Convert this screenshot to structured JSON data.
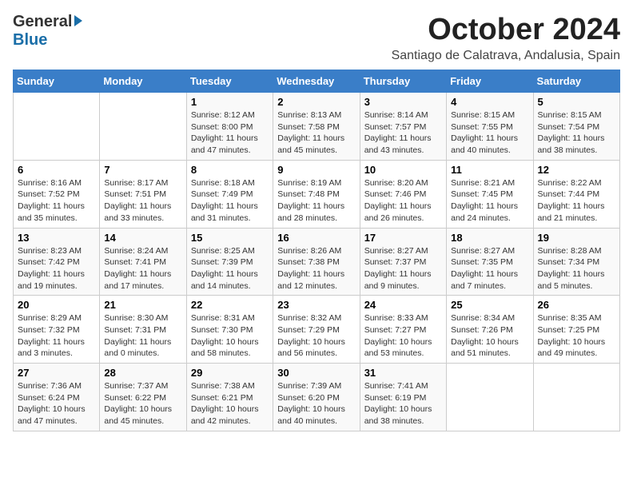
{
  "logo": {
    "general": "General",
    "blue": "Blue"
  },
  "title": "October 2024",
  "location": "Santiago de Calatrava, Andalusia, Spain",
  "headers": [
    "Sunday",
    "Monday",
    "Tuesday",
    "Wednesday",
    "Thursday",
    "Friday",
    "Saturday"
  ],
  "weeks": [
    [
      {
        "day": "",
        "info": ""
      },
      {
        "day": "",
        "info": ""
      },
      {
        "day": "1",
        "info": "Sunrise: 8:12 AM\nSunset: 8:00 PM\nDaylight: 11 hours and 47 minutes."
      },
      {
        "day": "2",
        "info": "Sunrise: 8:13 AM\nSunset: 7:58 PM\nDaylight: 11 hours and 45 minutes."
      },
      {
        "day": "3",
        "info": "Sunrise: 8:14 AM\nSunset: 7:57 PM\nDaylight: 11 hours and 43 minutes."
      },
      {
        "day": "4",
        "info": "Sunrise: 8:15 AM\nSunset: 7:55 PM\nDaylight: 11 hours and 40 minutes."
      },
      {
        "day": "5",
        "info": "Sunrise: 8:15 AM\nSunset: 7:54 PM\nDaylight: 11 hours and 38 minutes."
      }
    ],
    [
      {
        "day": "6",
        "info": "Sunrise: 8:16 AM\nSunset: 7:52 PM\nDaylight: 11 hours and 35 minutes."
      },
      {
        "day": "7",
        "info": "Sunrise: 8:17 AM\nSunset: 7:51 PM\nDaylight: 11 hours and 33 minutes."
      },
      {
        "day": "8",
        "info": "Sunrise: 8:18 AM\nSunset: 7:49 PM\nDaylight: 11 hours and 31 minutes."
      },
      {
        "day": "9",
        "info": "Sunrise: 8:19 AM\nSunset: 7:48 PM\nDaylight: 11 hours and 28 minutes."
      },
      {
        "day": "10",
        "info": "Sunrise: 8:20 AM\nSunset: 7:46 PM\nDaylight: 11 hours and 26 minutes."
      },
      {
        "day": "11",
        "info": "Sunrise: 8:21 AM\nSunset: 7:45 PM\nDaylight: 11 hours and 24 minutes."
      },
      {
        "day": "12",
        "info": "Sunrise: 8:22 AM\nSunset: 7:44 PM\nDaylight: 11 hours and 21 minutes."
      }
    ],
    [
      {
        "day": "13",
        "info": "Sunrise: 8:23 AM\nSunset: 7:42 PM\nDaylight: 11 hours and 19 minutes."
      },
      {
        "day": "14",
        "info": "Sunrise: 8:24 AM\nSunset: 7:41 PM\nDaylight: 11 hours and 17 minutes."
      },
      {
        "day": "15",
        "info": "Sunrise: 8:25 AM\nSunset: 7:39 PM\nDaylight: 11 hours and 14 minutes."
      },
      {
        "day": "16",
        "info": "Sunrise: 8:26 AM\nSunset: 7:38 PM\nDaylight: 11 hours and 12 minutes."
      },
      {
        "day": "17",
        "info": "Sunrise: 8:27 AM\nSunset: 7:37 PM\nDaylight: 11 hours and 9 minutes."
      },
      {
        "day": "18",
        "info": "Sunrise: 8:27 AM\nSunset: 7:35 PM\nDaylight: 11 hours and 7 minutes."
      },
      {
        "day": "19",
        "info": "Sunrise: 8:28 AM\nSunset: 7:34 PM\nDaylight: 11 hours and 5 minutes."
      }
    ],
    [
      {
        "day": "20",
        "info": "Sunrise: 8:29 AM\nSunset: 7:32 PM\nDaylight: 11 hours and 3 minutes."
      },
      {
        "day": "21",
        "info": "Sunrise: 8:30 AM\nSunset: 7:31 PM\nDaylight: 11 hours and 0 minutes."
      },
      {
        "day": "22",
        "info": "Sunrise: 8:31 AM\nSunset: 7:30 PM\nDaylight: 10 hours and 58 minutes."
      },
      {
        "day": "23",
        "info": "Sunrise: 8:32 AM\nSunset: 7:29 PM\nDaylight: 10 hours and 56 minutes."
      },
      {
        "day": "24",
        "info": "Sunrise: 8:33 AM\nSunset: 7:27 PM\nDaylight: 10 hours and 53 minutes."
      },
      {
        "day": "25",
        "info": "Sunrise: 8:34 AM\nSunset: 7:26 PM\nDaylight: 10 hours and 51 minutes."
      },
      {
        "day": "26",
        "info": "Sunrise: 8:35 AM\nSunset: 7:25 PM\nDaylight: 10 hours and 49 minutes."
      }
    ],
    [
      {
        "day": "27",
        "info": "Sunrise: 7:36 AM\nSunset: 6:24 PM\nDaylight: 10 hours and 47 minutes."
      },
      {
        "day": "28",
        "info": "Sunrise: 7:37 AM\nSunset: 6:22 PM\nDaylight: 10 hours and 45 minutes."
      },
      {
        "day": "29",
        "info": "Sunrise: 7:38 AM\nSunset: 6:21 PM\nDaylight: 10 hours and 42 minutes."
      },
      {
        "day": "30",
        "info": "Sunrise: 7:39 AM\nSunset: 6:20 PM\nDaylight: 10 hours and 40 minutes."
      },
      {
        "day": "31",
        "info": "Sunrise: 7:41 AM\nSunset: 6:19 PM\nDaylight: 10 hours and 38 minutes."
      },
      {
        "day": "",
        "info": ""
      },
      {
        "day": "",
        "info": ""
      }
    ]
  ]
}
